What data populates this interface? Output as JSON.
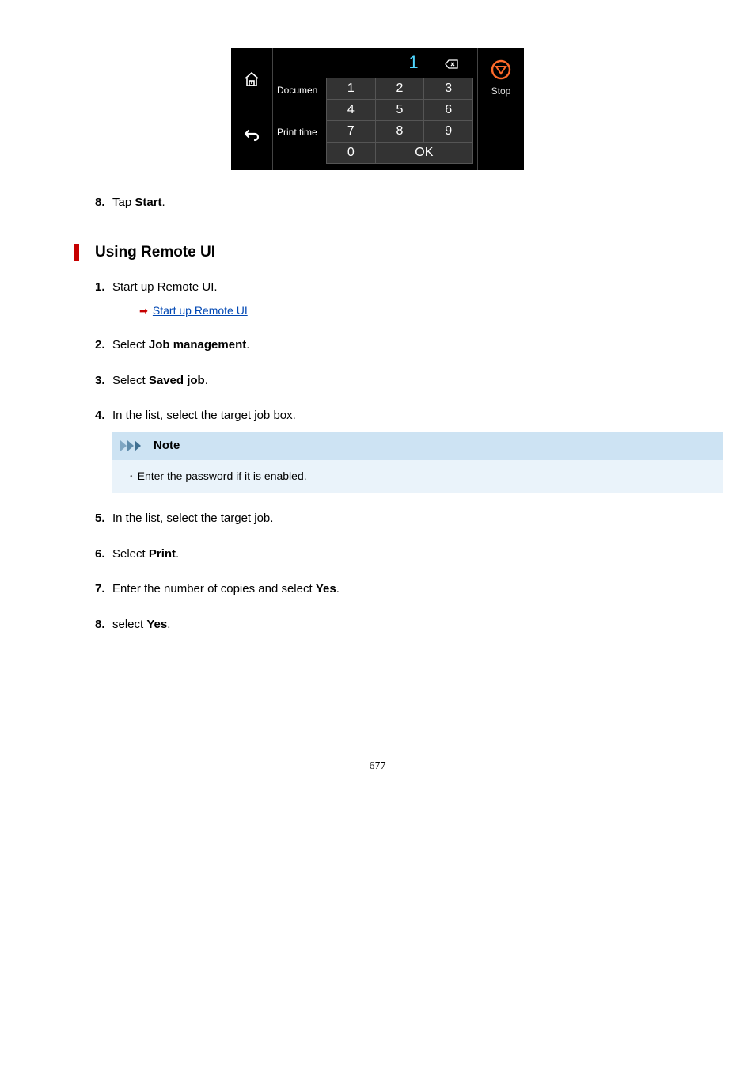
{
  "device": {
    "left_label_top": "Documen",
    "left_label_bottom": "Print time",
    "display_value": "1",
    "keys": {
      "k1": "1",
      "k2": "2",
      "k3": "3",
      "k4": "4",
      "k5": "5",
      "k6": "6",
      "k7": "7",
      "k8": "8",
      "k9": "9",
      "k0": "0",
      "ok": "OK"
    },
    "stop_label": "Stop"
  },
  "step8a": {
    "num": "8.",
    "text_before": "Tap ",
    "bold": "Start",
    "text_after": "."
  },
  "section_heading": "Using Remote UI",
  "steps_b": {
    "s1": {
      "num": "1.",
      "text": "Start up Remote UI.",
      "link": "Start up Remote UI"
    },
    "s2": {
      "num": "2.",
      "before": "Select ",
      "bold": "Job management",
      "after": "."
    },
    "s3": {
      "num": "3.",
      "before": "Select ",
      "bold": "Saved job",
      "after": "."
    },
    "s4": {
      "num": "4.",
      "text": "In the list, select the target job box."
    },
    "note": {
      "title": "Note",
      "body": "Enter the password if it is enabled."
    },
    "s5": {
      "num": "5.",
      "text": "In the list, select the target job."
    },
    "s6": {
      "num": "6.",
      "before": "Select ",
      "bold": "Print",
      "after": "."
    },
    "s7": {
      "num": "7.",
      "before": "Enter the number of copies and select ",
      "bold": "Yes",
      "after": "."
    },
    "s8": {
      "num": "8.",
      "before": "select ",
      "bold": "Yes",
      "after": "."
    }
  },
  "page_number": "677"
}
